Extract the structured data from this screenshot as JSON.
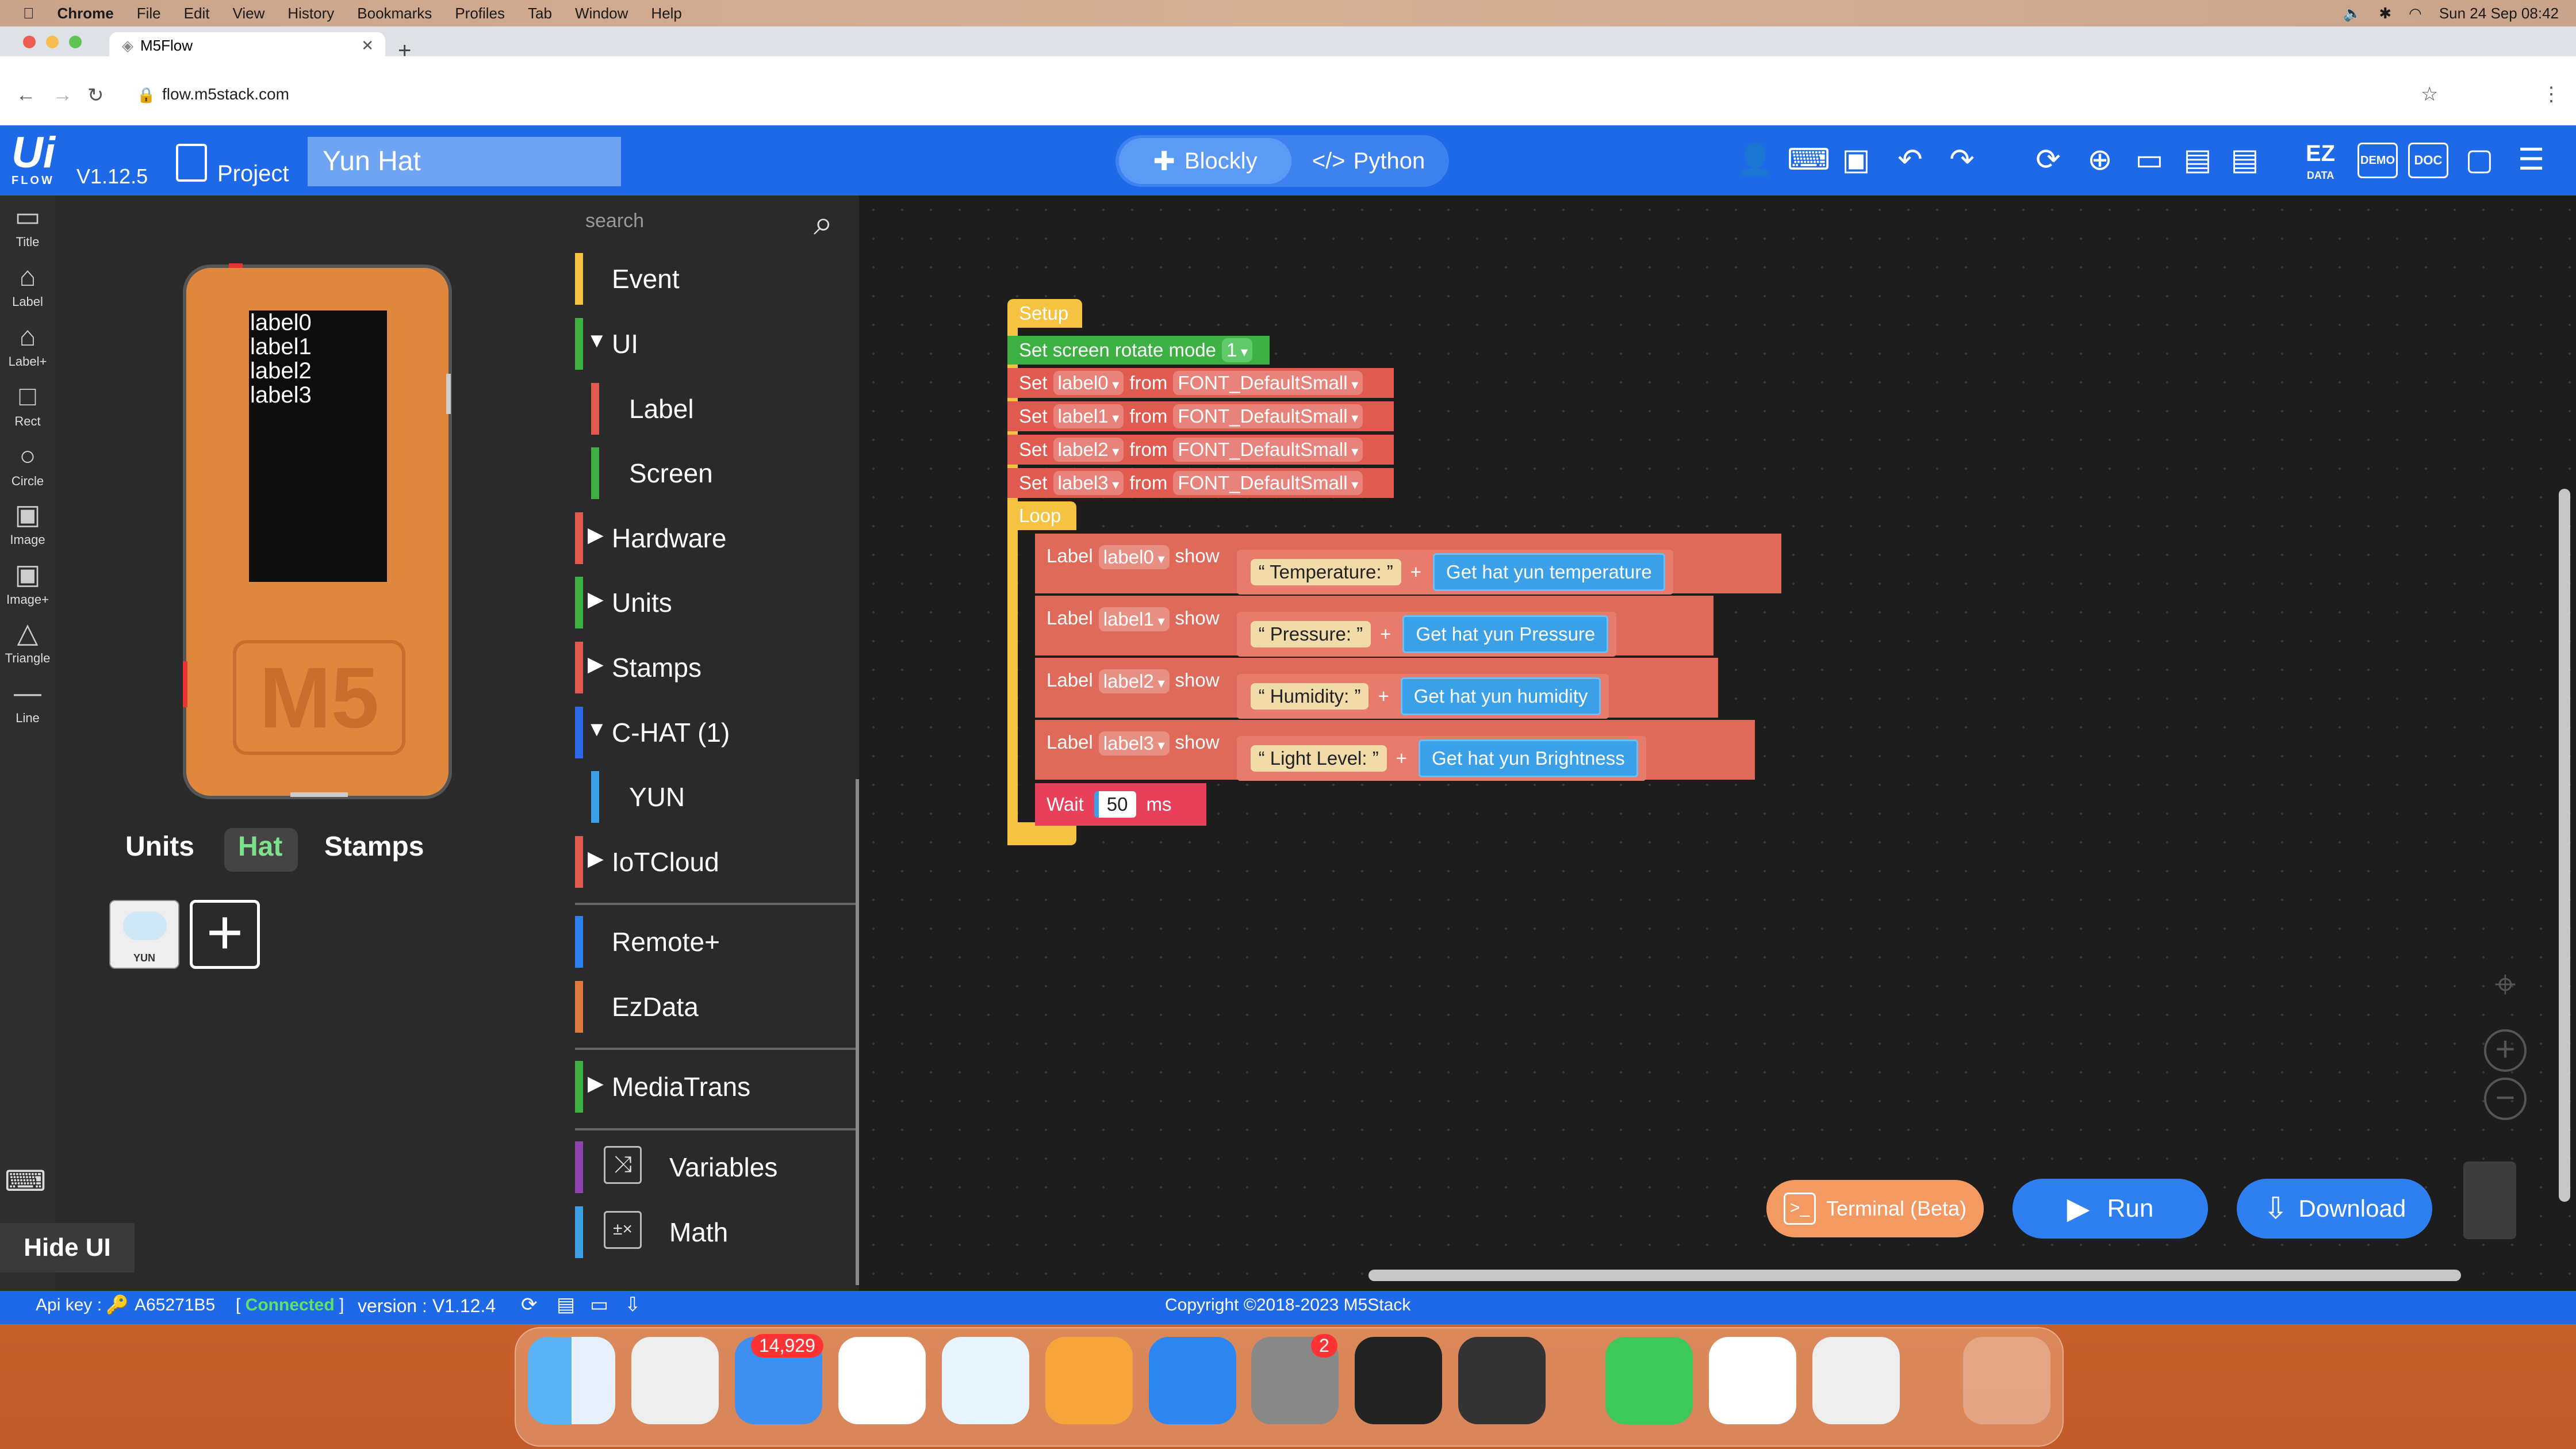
{
  "menubar": {
    "app": "Chrome",
    "items": [
      "File",
      "Edit",
      "View",
      "History",
      "Bookmarks",
      "Profiles",
      "Tab",
      "Window",
      "Help"
    ],
    "datetime": "Sun 24 Sep  08:42"
  },
  "browser": {
    "tab_title": "M5Flow",
    "url": "flow.m5stack.com"
  },
  "header": {
    "logo": "Ui",
    "logo_sub": "FLOW",
    "version": "V1.12.5",
    "project_label": "Project",
    "project_name": "Yun Hat",
    "blockly": "Blockly",
    "python": "Python",
    "ez_data": "EZ",
    "ez_data_sub": "DATA",
    "demo": "DEMO",
    "doc": "DOC"
  },
  "tools": [
    {
      "label": "Title",
      "icon": "▭"
    },
    {
      "label": "Label",
      "icon": "⌂"
    },
    {
      "label": "Label+",
      "icon": "⌂"
    },
    {
      "label": "Rect",
      "icon": "□"
    },
    {
      "label": "Circle",
      "icon": "○"
    },
    {
      "label": "Image",
      "icon": "▣"
    },
    {
      "label": "Image+",
      "icon": "▣"
    },
    {
      "label": "Triangle",
      "icon": "△"
    },
    {
      "label": "Line",
      "icon": "—"
    }
  ],
  "device": {
    "labels": [
      "label0",
      "label1",
      "label2",
      "label3"
    ],
    "badge": "M5"
  },
  "panel_tabs": {
    "units": "Units",
    "hat": "Hat",
    "stamps": "Stamps"
  },
  "hat_icon_label": "YUN",
  "hide_ui": "Hide UI",
  "palette": {
    "search_placeholder": "search",
    "categories": [
      {
        "label": "Event",
        "color": "#f5c242"
      },
      {
        "label": "UI",
        "color": "#3cb043"
      },
      {
        "label": "Label",
        "color": "#e05a4f"
      },
      {
        "label": "Screen",
        "color": "#3cb043"
      },
      {
        "label": "Hardware",
        "color": "#e05a4f"
      },
      {
        "label": "Units",
        "color": "#3cb043"
      },
      {
        "label": "Stamps",
        "color": "#e05a4f"
      },
      {
        "label": "C-HAT (1)",
        "color": "#2e6ae8"
      },
      {
        "label": "YUN",
        "color": "#3aa0e8"
      },
      {
        "label": "IoTCloud",
        "color": "#e05a4f"
      },
      {
        "label": "Remote+",
        "color": "#2e80f0"
      },
      {
        "label": "EzData",
        "color": "#e0783e"
      },
      {
        "label": "MediaTrans",
        "color": "#3cb043"
      },
      {
        "label": "Variables",
        "color": "#8e44ad"
      },
      {
        "label": "Math",
        "color": "#3aa0e8"
      }
    ]
  },
  "workspace": {
    "setup": "Setup",
    "rotate": {
      "text": "Set screen rotate mode",
      "value": "1"
    },
    "set_fonts": [
      {
        "set": "Set",
        "label": "label0",
        "from": "from",
        "font": "FONT_DefaultSmall"
      },
      {
        "set": "Set",
        "label": "label1",
        "from": "from",
        "font": "FONT_DefaultSmall"
      },
      {
        "set": "Set",
        "label": "label2",
        "from": "from",
        "font": "FONT_DefaultSmall"
      },
      {
        "set": "Set",
        "label": "label3",
        "from": "from",
        "font": "FONT_DefaultSmall"
      }
    ],
    "loop": "Loop",
    "shows": [
      {
        "label_kw": "Label",
        "label": "label0",
        "show": "show",
        "text": "Temperature:",
        "plus": "+",
        "getter": "Get hat yun temperature"
      },
      {
        "label_kw": "Label",
        "label": "label1",
        "show": "show",
        "text": "Pressure:",
        "plus": "+",
        "getter": "Get hat yun Pressure"
      },
      {
        "label_kw": "Label",
        "label": "label2",
        "show": "show",
        "text": "Humidity:",
        "plus": "+",
        "getter": "Get hat yun humidity"
      },
      {
        "label_kw": "Label",
        "label": "label3",
        "show": "show",
        "text": "Light Level:",
        "plus": "+",
        "getter": "Get hat yun Brightness"
      }
    ],
    "wait": {
      "text": "Wait",
      "value": "50",
      "unit": "ms"
    }
  },
  "buttons": {
    "terminal": "Terminal (Beta)",
    "run": "Run",
    "download": "Download"
  },
  "statusbar": {
    "api_key_label": "Api key :",
    "api_key": "A65271B5",
    "connected": "Connected",
    "version_label": "version : V1.12.4",
    "copyright": "Copyright ©2018-2023 M5Stack"
  },
  "dock": {
    "mail_badge": "14,929",
    "settings_badge": "2"
  },
  "colors": {
    "header_blue": "#1e69e8",
    "setup_yellow": "#f5c242",
    "set_red": "#e05a4f",
    "rotate_green": "#3cb043",
    "show_red": "#e06a5a",
    "getter_blue": "#3aa0e8"
  }
}
